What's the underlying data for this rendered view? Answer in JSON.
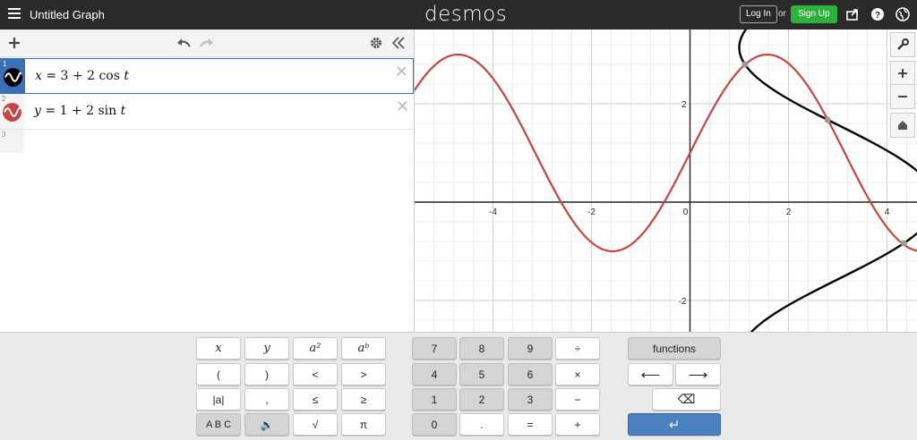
{
  "header": {
    "title": "Untitled Graph",
    "brand": "desmos",
    "login_label": "Log In",
    "or_label": "or",
    "signup_label": "Sign Up"
  },
  "expressions": [
    {
      "index": "1",
      "lhs": "x",
      "rhs_a": "3 + 2 cos ",
      "param": "t",
      "color": "#000000"
    },
    {
      "index": "2",
      "lhs": "y",
      "rhs_a": "1 + 2 sin ",
      "param": "t",
      "color": "#c74440"
    },
    {
      "index": "3"
    }
  ],
  "graph": {
    "x_ticks": [
      "-4",
      "-2",
      "0",
      "2",
      "4"
    ],
    "y_ticks": [
      "2",
      "-2"
    ],
    "curves": [
      {
        "name": "x = 3 + 2 cos t",
        "color": "#000000"
      },
      {
        "name": "y = 1 + 2 sin t",
        "color": "#c74440"
      }
    ]
  },
  "keypad": {
    "left": [
      [
        "x",
        "y",
        "a²",
        "aᵇ"
      ],
      [
        "(",
        ")",
        "<",
        ">"
      ],
      [
        "|a|",
        ",",
        "≤",
        "≥"
      ],
      [
        "A B C",
        "🔈",
        "√",
        "π"
      ]
    ],
    "numbers": [
      [
        "7",
        "8",
        "9",
        "÷"
      ],
      [
        "4",
        "5",
        "6",
        "×"
      ],
      [
        "1",
        "2",
        "3",
        "−"
      ],
      [
        "0",
        ".",
        "=",
        "+"
      ]
    ],
    "functions_label": "functions",
    "left_arrow": "⟵",
    "right_arrow": "⟶",
    "backspace": "⌫",
    "enter": "↵"
  }
}
